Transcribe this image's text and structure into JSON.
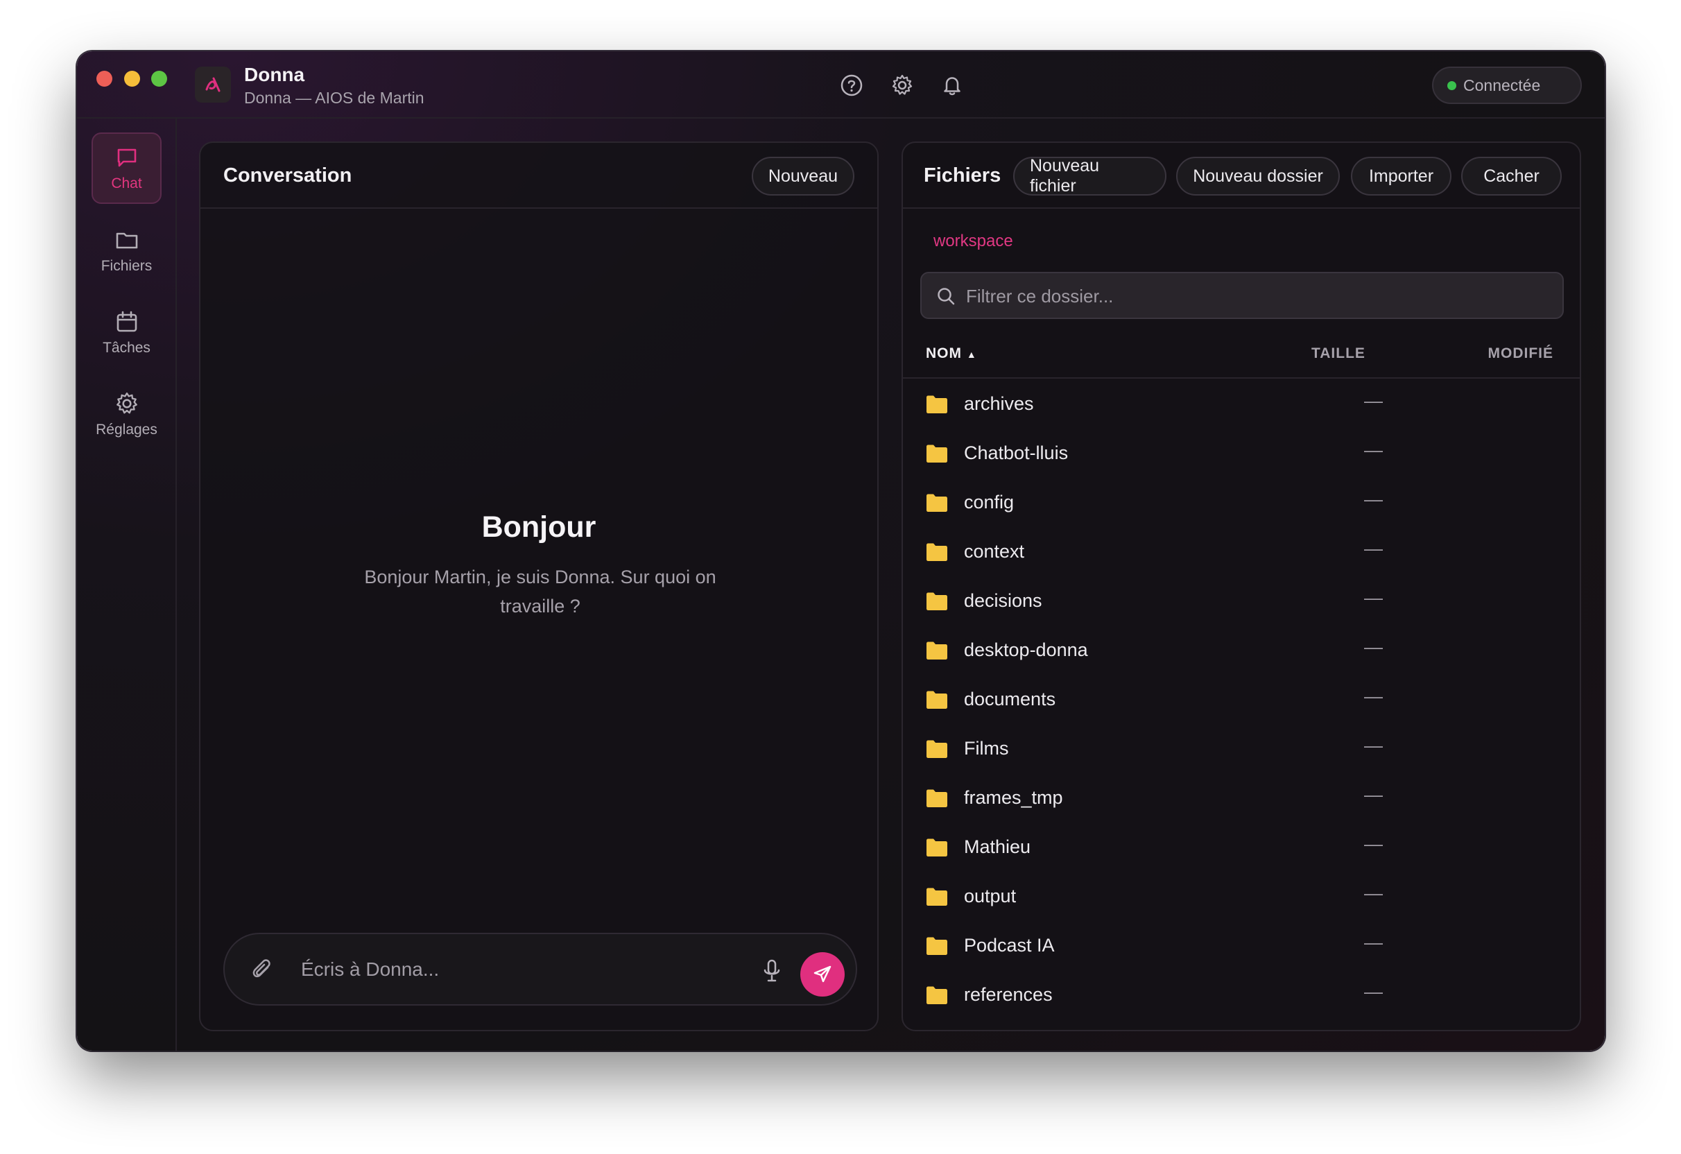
{
  "app": {
    "title": "Donna",
    "subtitle": "Donna — AIOS de Martin",
    "status": "Connectée",
    "accent": "#e02f7f",
    "status_color": "#39c14d"
  },
  "titlebar_icons": [
    "help-icon",
    "settings-icon",
    "bell-icon"
  ],
  "sidebar": {
    "items": [
      {
        "label": "Chat",
        "icon": "chat-bubble-icon",
        "active": true
      },
      {
        "label": "Fichiers",
        "icon": "folder-icon",
        "active": false
      },
      {
        "label": "Tâches",
        "icon": "calendar-icon",
        "active": false
      },
      {
        "label": "Réglages",
        "icon": "gear-icon",
        "active": false
      }
    ]
  },
  "conversation": {
    "title": "Conversation",
    "new_label": "Nouveau",
    "greeting": "Bonjour",
    "greeting_sub": "Bonjour Martin, je suis Donna. Sur quoi on travaille ?",
    "input_placeholder": "Écris à Donna..."
  },
  "files": {
    "title": "Fichiers",
    "actions": {
      "new_file": "Nouveau fichier",
      "new_folder": "Nouveau dossier",
      "import": "Importer",
      "hide": "Cacher"
    },
    "breadcrumb": "workspace",
    "filter_placeholder": "Filtrer ce dossier...",
    "columns": {
      "name": "NOM",
      "sort_indicator": "▲",
      "size": "TAILLE",
      "modified": "MODIFIÉ"
    },
    "folder_color": "#f5c542",
    "rows": [
      {
        "name": "archives",
        "size": "—"
      },
      {
        "name": "Chatbot-lluis",
        "size": "—"
      },
      {
        "name": "config",
        "size": "—"
      },
      {
        "name": "context",
        "size": "—"
      },
      {
        "name": "decisions",
        "size": "—"
      },
      {
        "name": "desktop-donna",
        "size": "—"
      },
      {
        "name": "documents",
        "size": "—"
      },
      {
        "name": "Films",
        "size": "—"
      },
      {
        "name": "frames_tmp",
        "size": "—"
      },
      {
        "name": "Mathieu",
        "size": "—"
      },
      {
        "name": "output",
        "size": "—"
      },
      {
        "name": "Podcast IA",
        "size": "—"
      },
      {
        "name": "references",
        "size": "—"
      }
    ]
  }
}
